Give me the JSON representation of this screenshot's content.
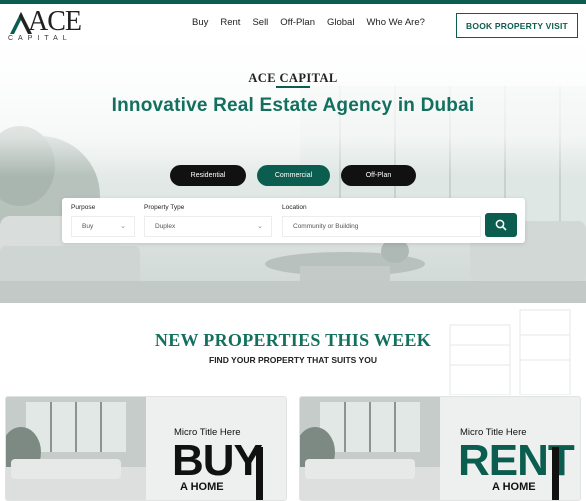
{
  "brand": {
    "logo_word": "ACE",
    "logo_sub": "CAPITAL",
    "accent": "#0b5e4f"
  },
  "nav": {
    "items": [
      "Buy",
      "Rent",
      "Sell",
      "Off-Plan",
      "Global",
      "Who We Are?"
    ],
    "cta": "BOOK PROPERTY VISIT"
  },
  "hero": {
    "brand_title": "ACE CAPITAL",
    "headline": "Innovative Real Estate Agency in Dubai",
    "tabs": [
      {
        "label": "Residential",
        "active": false
      },
      {
        "label": "Commercial",
        "active": true
      },
      {
        "label": "Off-Plan",
        "active": false
      }
    ],
    "search": {
      "purpose_label": "Purpose",
      "purpose_value": "Buy",
      "type_label": "Property Type",
      "type_value": "Duplex",
      "location_label": "Location",
      "location_placeholder": "Community or Building"
    }
  },
  "section": {
    "title": "NEW PROPERTIES THIS WEEK",
    "subtitle": "FIND YOUR PROPERTY THAT SUITS YOU"
  },
  "cards": [
    {
      "micro": "Micro Title Here",
      "big": "BUY",
      "home": "A HOME",
      "color": "#111111"
    },
    {
      "micro": "Micro Title Here",
      "big": "RENT",
      "home": "A HOME",
      "color": "#0b5e4f"
    }
  ]
}
